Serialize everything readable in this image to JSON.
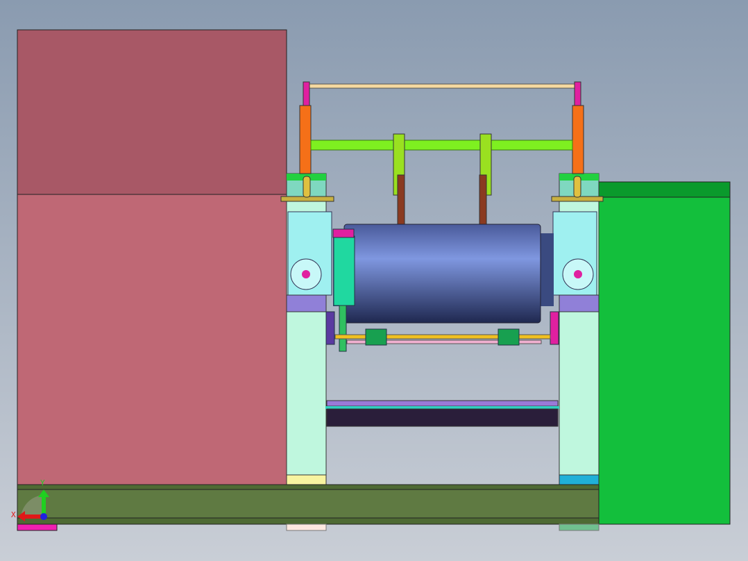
{
  "viewport": {
    "type": "cad-3d-view"
  },
  "triad": {
    "x_label": "X",
    "y_label": "Y"
  },
  "colors": {
    "left_block_top": "#a85866",
    "left_block_bottom": "#bf6875",
    "right_block": "#13bf3c",
    "base_beam": "#5f7a42",
    "roller": "#7890d8",
    "pillar": "#bff7de",
    "gearbox": "#9ff0f0"
  }
}
